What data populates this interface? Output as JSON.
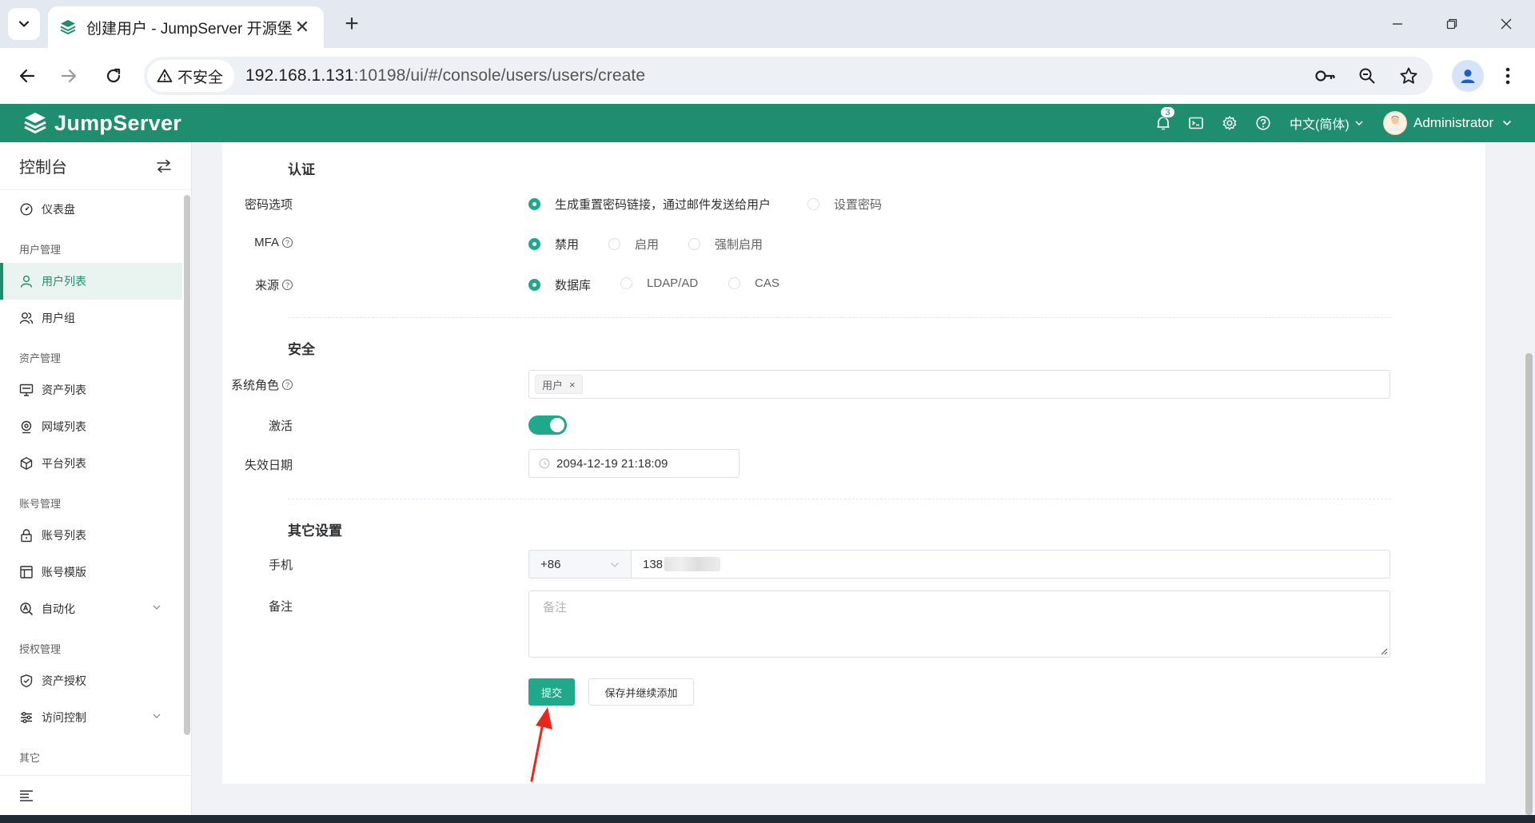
{
  "browser": {
    "tab_title": "创建用户 - JumpServer 开源堡",
    "tab_close": "✕",
    "new_tab": "+",
    "security_label": "不安全",
    "url_host": "192.168.1.131",
    "url_rest": ":10198/ui/#/console/users/users/create"
  },
  "header": {
    "logo": "JumpServer",
    "notification_count": "3",
    "language": "中文(简体)",
    "user": "Administrator"
  },
  "sidebar": {
    "title": "控制台",
    "items": [
      {
        "type": "item",
        "label": "仪表盘",
        "icon": "dashboard-icon"
      },
      {
        "type": "group",
        "label": "用户管理"
      },
      {
        "type": "item",
        "label": "用户列表",
        "icon": "user-icon",
        "active": true
      },
      {
        "type": "item",
        "label": "用户组",
        "icon": "users-icon"
      },
      {
        "type": "group",
        "label": "资产管理"
      },
      {
        "type": "item",
        "label": "资产列表",
        "icon": "monitor-icon"
      },
      {
        "type": "item",
        "label": "网域列表",
        "icon": "location-icon"
      },
      {
        "type": "item",
        "label": "平台列表",
        "icon": "cube-icon"
      },
      {
        "type": "group",
        "label": "账号管理"
      },
      {
        "type": "item",
        "label": "账号列表",
        "icon": "lock-icon"
      },
      {
        "type": "item",
        "label": "账号模版",
        "icon": "template-icon"
      },
      {
        "type": "item",
        "label": "自动化",
        "icon": "automation-icon",
        "expandable": true
      },
      {
        "type": "group",
        "label": "授权管理"
      },
      {
        "type": "item",
        "label": "资产授权",
        "icon": "shield-icon"
      },
      {
        "type": "item",
        "label": "访问控制",
        "icon": "access-control-icon",
        "expandable": true
      },
      {
        "type": "group",
        "label": "其它"
      }
    ]
  },
  "form": {
    "auth": {
      "title": "认证",
      "password_option_label": "密码选项",
      "password_options": [
        "生成重置密码链接，通过邮件发送给用户",
        "设置密码"
      ],
      "mfa_label": "MFA",
      "mfa_options": [
        "禁用",
        "启用",
        "强制启用"
      ],
      "source_label": "来源",
      "source_options": [
        "数据库",
        "LDAP/AD",
        "CAS"
      ]
    },
    "security": {
      "title": "安全",
      "role_label": "系统角色",
      "role_tag": "用户",
      "tag_close": "×",
      "active_label": "激活",
      "expire_label": "失效日期",
      "expire_value": "2094-12-19 21:18:09"
    },
    "other": {
      "title": "其它设置",
      "phone_label": "手机",
      "phone_code": "+86",
      "phone_value": "138",
      "comment_label": "备注",
      "comment_placeholder": "备注"
    },
    "submit_label": "提交",
    "save_continue_label": "保存并继续添加"
  },
  "colors": {
    "brand": "#1f8e6f",
    "primary": "#1fa88a",
    "annotation_arrow": "#e8261c"
  }
}
